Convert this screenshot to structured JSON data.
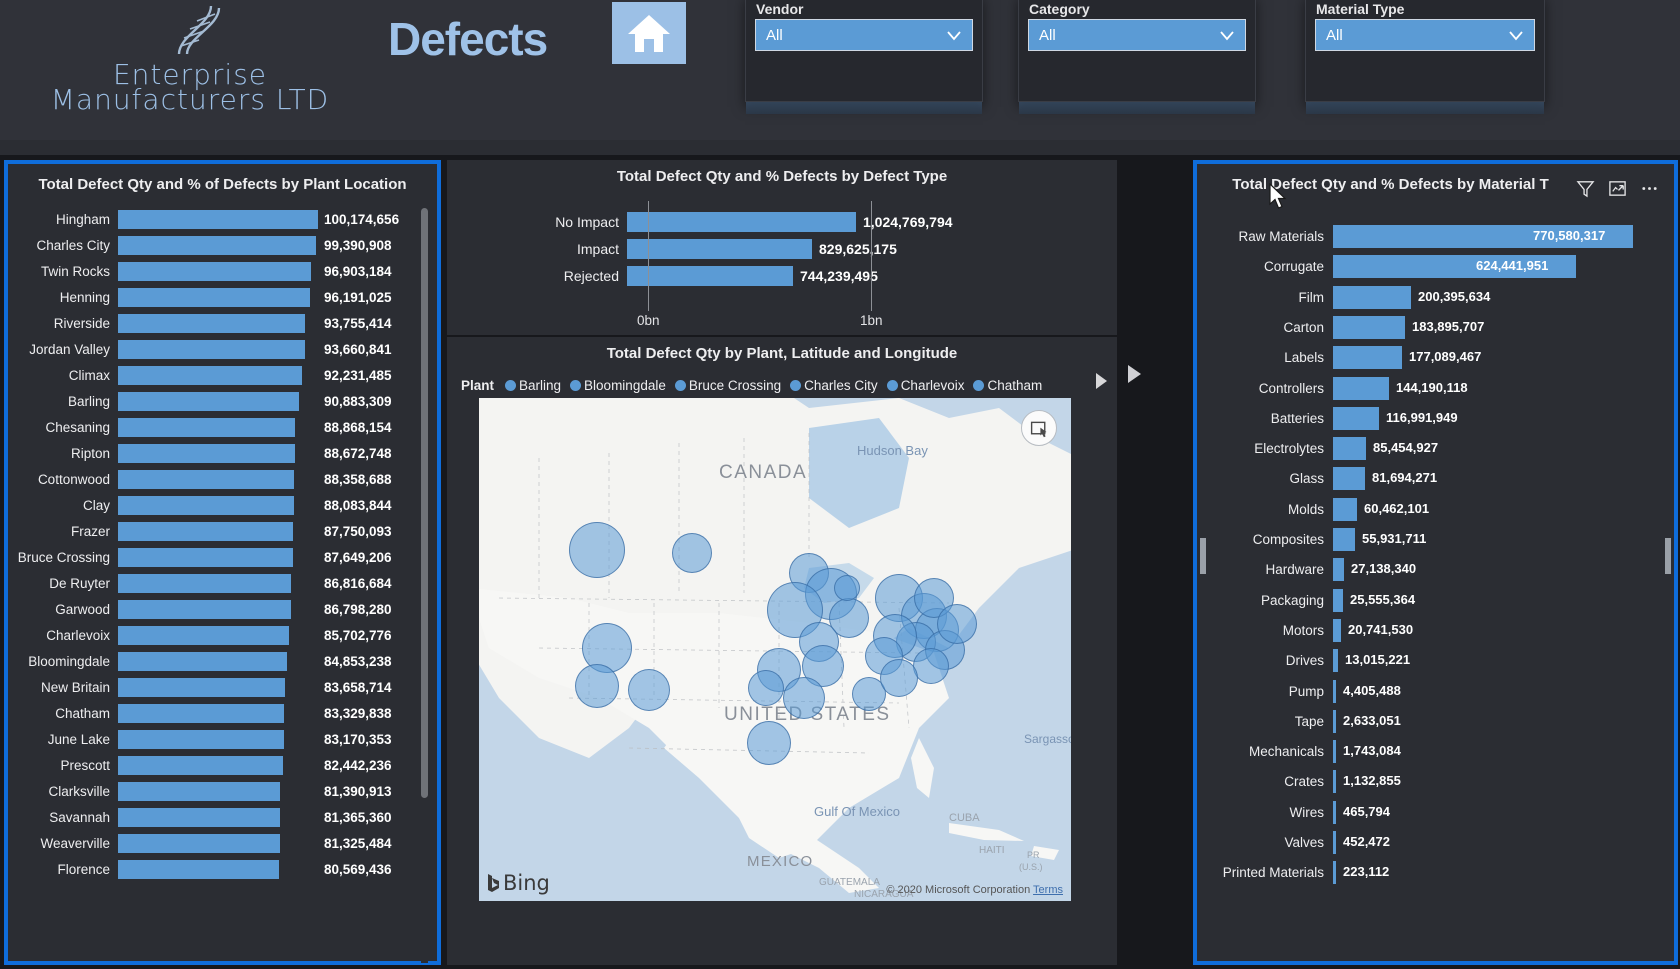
{
  "header": {
    "brand_line1": "Enterprise",
    "brand_line2": "Manufacturers LTD",
    "title": "Defects",
    "home_icon": "home-icon",
    "dna_icon": "dna-helix-icon",
    "slicers": [
      {
        "label": "Vendor",
        "value": "All",
        "icon": "chevron-down-icon"
      },
      {
        "label": "Category",
        "value": "All",
        "icon": "chevron-down-icon"
      },
      {
        "label": "Material Type",
        "value": "All",
        "icon": "chevron-down-icon"
      }
    ]
  },
  "plant_chart": {
    "title": "Total Defect Qty and % of Defects by Plant Location"
  },
  "defect_chart": {
    "title": "Total Defect Qty and % Defects by Defect Type"
  },
  "map_chart": {
    "title": "Total Defect Qty by Plant, Latitude and Longitude",
    "legend_title": "Plant",
    "legend": [
      "Barling",
      "Bloomingdale",
      "Bruce Crossing",
      "Charles City",
      "Charlevoix",
      "Chatham"
    ],
    "legend_more_icon": "chevron-right-icon",
    "focus_icon": "map-select-icon",
    "bing_label": "Bing",
    "credit": "© 2020 Microsoft Corporation",
    "credit_link": "Terms",
    "map_labels": [
      "CANADA",
      "UNITED STATES",
      "MEXICO",
      "Hudson Bay",
      "Gulf Of Mexico",
      "CUBA",
      "HAITI",
      "PR (U.S.)",
      "GUATEMALA",
      "NICARAGUA",
      "Sargasso S"
    ]
  },
  "material_chart": {
    "title": "Total Defect Qty and % Defects by Material T",
    "tools": [
      {
        "name": "filter-icon"
      },
      {
        "name": "focus-mode-icon"
      },
      {
        "name": "more-options-icon"
      }
    ]
  },
  "chart_data": [
    {
      "type": "bar",
      "title": "Total Defect Qty and % of Defects by Plant Location",
      "orientation": "horizontal",
      "xlabel": "",
      "ylabel": "Plant Location",
      "categories": [
        "Hingham",
        "Charles City",
        "Twin Rocks",
        "Henning",
        "Riverside",
        "Jordan Valley",
        "Climax",
        "Barling",
        "Chesaning",
        "Ripton",
        "Cottonwood",
        "Clay",
        "Frazer",
        "Bruce Crossing",
        "De Ruyter",
        "Garwood",
        "Charlevoix",
        "Bloomingdale",
        "New Britain",
        "Chatham",
        "June Lake",
        "Prescott",
        "Clarksville",
        "Savannah",
        "Weaverville",
        "Florence"
      ],
      "values": [
        100174656,
        99390908,
        96903184,
        96191025,
        93755414,
        93660841,
        92231485,
        90883309,
        88868154,
        88672748,
        88358688,
        88083844,
        87750093,
        87649206,
        86816684,
        86798280,
        85702776,
        84853238,
        83658714,
        83329838,
        83170353,
        82442236,
        81390913,
        81365360,
        81325484,
        80569436
      ],
      "value_labels": [
        "100,174,656",
        "99,390,908",
        "96,903,184",
        "96,191,025",
        "93,755,414",
        "93,660,841",
        "92,231,485",
        "90,883,309",
        "88,868,154",
        "88,672,748",
        "88,358,688",
        "88,083,844",
        "87,750,093",
        "87,649,206",
        "86,816,684",
        "86,798,280",
        "85,702,776",
        "84,853,238",
        "83,658,714",
        "83,329,838",
        "83,170,353",
        "82,442,236",
        "81,390,913",
        "81,365,360",
        "81,325,484",
        "80,569,436"
      ],
      "grid": false,
      "legend": "none"
    },
    {
      "type": "bar",
      "title": "Total Defect Qty and % Defects by Defect Type",
      "orientation": "horizontal",
      "categories": [
        "No Impact",
        "Impact",
        "Rejected"
      ],
      "values": [
        1024769794,
        829625175,
        744239495
      ],
      "value_labels": [
        "1,024,769,794",
        "829,625,175",
        "744,239,495"
      ],
      "xticks": [
        "0bn",
        "1bn"
      ],
      "xlim": [
        0,
        1100000000
      ],
      "grid": true,
      "legend": "none"
    },
    {
      "type": "bar",
      "title": "Total Defect Qty and % Defects by Material Type",
      "orientation": "horizontal",
      "categories": [
        "Raw Materials",
        "Corrugate",
        "Film",
        "Carton",
        "Labels",
        "Controllers",
        "Batteries",
        "Electrolytes",
        "Glass",
        "Molds",
        "Composites",
        "Hardware",
        "Packaging",
        "Motors",
        "Drives",
        "Pump",
        "Tape",
        "Mechanicals",
        "Crates",
        "Wires",
        "Valves",
        "Printed Materials"
      ],
      "values": [
        770580317,
        624441951,
        200395634,
        183895707,
        177089467,
        144190118,
        116991949,
        85454927,
        81694271,
        60462101,
        55931711,
        27138340,
        25555364,
        20741530,
        13015221,
        4405488,
        2633051,
        1743084,
        1132855,
        465794,
        452472,
        223112
      ],
      "value_labels": [
        "770,580,317",
        "624,441,951",
        "200,395,634",
        "183,895,707",
        "177,089,467",
        "144,190,118",
        "116,991,949",
        "85,454,927",
        "81,694,271",
        "60,462,101",
        "55,931,711",
        "27,138,340",
        "25,555,364",
        "20,741,530",
        "13,015,221",
        "4,405,488",
        "2,633,051",
        "1,743,084",
        "1,132,855",
        "465,794",
        "452,472",
        "223,112"
      ],
      "grid": false,
      "legend": "none"
    },
    {
      "type": "scatter",
      "subtype": "bubble-map",
      "title": "Total Defect Qty by Plant, Latitude and Longitude",
      "legend_entries": [
        "Barling",
        "Bloomingdale",
        "Bruce Crossing",
        "Charles City",
        "Charlevoix",
        "Chatham"
      ],
      "basemap": "Bing Maps road (light)",
      "region": "North America"
    }
  ],
  "colors": {
    "accent": "#5b9bd5",
    "selection_border": "#0f6ddb",
    "card_bg": "#2b2d33",
    "page_bg": "#17181c",
    "header_bg": "#303239",
    "text": "#eeeef0",
    "brand": "#9dc0e6"
  }
}
